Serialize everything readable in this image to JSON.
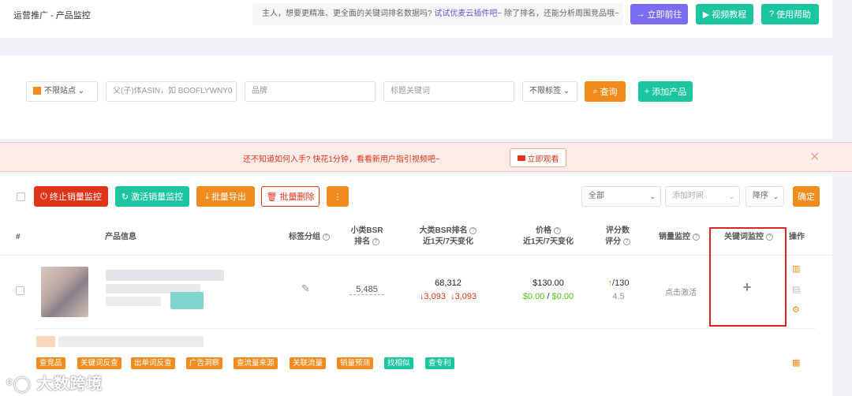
{
  "header": {
    "breadcrumb": "运营推广 - 产品监控",
    "tip_text": "主人，想要更精准、更全面的关键词排名数据吗?",
    "tip_link": "试试优麦云插件吧~",
    "tip_suffix": "除了排名，还能分析周围竞品哦~",
    "goto_label": "立即前往",
    "video_label": "视频教程",
    "help_label": "使用帮助"
  },
  "filters": {
    "site_label": "不限站点",
    "asin_placeholder": "父(子)体ASIN，如 BOOFLYWNY0",
    "brand_placeholder": "品牌",
    "keyword_placeholder": "标题关键词",
    "tag_label": "不限标签",
    "search_label": "查询",
    "add_label": "添加产品"
  },
  "banner": {
    "text": "还不知道如何入手? 快花1分钟，看看新用户指引视频吧~",
    "watch_label": "立即观看"
  },
  "toolbar": {
    "stop_label": "终止销量监控",
    "activate_label": "激活销量监控",
    "export_label": "批量导出",
    "delete_label": "批量删除",
    "more_label": "⋮",
    "filter_all": "全部",
    "sort_time": "添加时间",
    "sort_order": "降序",
    "confirm_label": "确定"
  },
  "table": {
    "headers": {
      "index": "#",
      "product": "产品信息",
      "tag_group": "标签分组",
      "small_bsr_1": "小类BSR",
      "small_bsr_2": "排名",
      "big_bsr_1": "大类BSR排名",
      "big_bsr_2": "近1天/7天变化",
      "price_1": "价格",
      "price_2": "近1天/7天变化",
      "rating_1": "评分数",
      "rating_2": "评分",
      "sales_monitor": "销量监控",
      "keyword_monitor": "关键词监控",
      "actions": "操作"
    },
    "row": {
      "small_bsr": "5,485",
      "big_bsr": "68,312",
      "big_bsr_d1": "↓3,093",
      "big_bsr_d7": "↓3,093",
      "price": "$130.00",
      "price_d1": "$0.00",
      "price_sep": "/",
      "price_d7": "$0.00",
      "rating_count_arrow": "↑",
      "rating_count": "/130",
      "rating": "4.5",
      "sales_action": "点击激活",
      "keyword_add": "+"
    },
    "tags": [
      "查竞品",
      "关键词反查",
      "出单词反查",
      "广告洞察",
      "查流量来源",
      "关联流量",
      "销量预测",
      "找相似",
      "查专利"
    ]
  },
  "watermark": "大数跨境",
  "colors": {
    "accent_purple": "#7b6cf6",
    "accent_teal": "#1bc5a0",
    "accent_orange": "#f08c1e",
    "accent_red": "#e0341a",
    "down_red": "#e0341a",
    "up_green": "#52c41a"
  }
}
